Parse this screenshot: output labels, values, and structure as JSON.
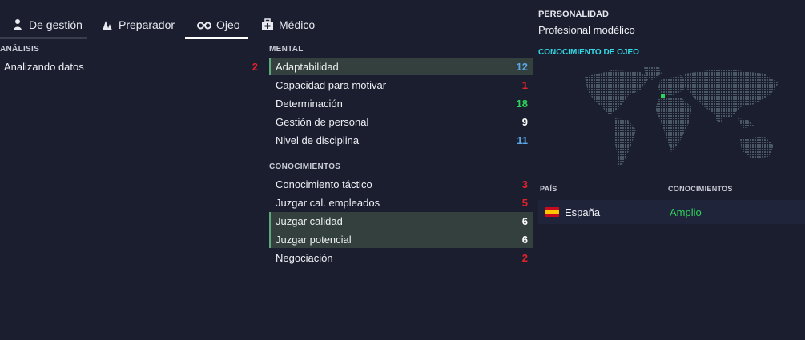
{
  "tabs": [
    {
      "label": "De gestión",
      "icon": "person-icon",
      "active": false
    },
    {
      "label": "Preparador",
      "icon": "cones-icon",
      "active": false
    },
    {
      "label": "Ojeo",
      "icon": "binoculars-icon",
      "active": true
    },
    {
      "label": "Médico",
      "icon": "medical-kit-icon",
      "active": false
    }
  ],
  "analysis": {
    "header": "ANÁLISIS",
    "items": [
      {
        "label": "Analizando datos",
        "value": "2"
      }
    ]
  },
  "mental": {
    "header": "MENTAL",
    "items": [
      {
        "label": "Adaptabilidad",
        "value": "12"
      },
      {
        "label": "Capacidad para motivar",
        "value": "1"
      },
      {
        "label": "Determinación",
        "value": "18"
      },
      {
        "label": "Gestión de personal",
        "value": "9"
      },
      {
        "label": "Nivel de disciplina",
        "value": "11"
      }
    ]
  },
  "knowledge": {
    "header": "CONOCIMIENTOS",
    "items": [
      {
        "label": "Conocimiento táctico",
        "value": "3"
      },
      {
        "label": "Juzgar cal. empleados",
        "value": "5"
      },
      {
        "label": "Juzgar calidad",
        "value": "6"
      },
      {
        "label": "Juzgar potencial",
        "value": "6"
      },
      {
        "label": "Negociación",
        "value": "2"
      }
    ]
  },
  "personality": {
    "header": "PERSONALIDAD",
    "value": "Profesional modélico"
  },
  "scouting": {
    "header": "CONOCIMIENTO DE OJEO",
    "col_country": "PAÍS",
    "col_knowledge": "CONOCIMIENTOS",
    "rows": [
      {
        "country": "España",
        "knowledge": "Amplio"
      }
    ]
  },
  "colors": {
    "background": "#1b1e2f",
    "highlight_row": "#34403d",
    "accent_cyan": "#34d9e6",
    "good": "#2ed35a",
    "bad": "#e3222c",
    "mid": "#5aa6e6"
  }
}
